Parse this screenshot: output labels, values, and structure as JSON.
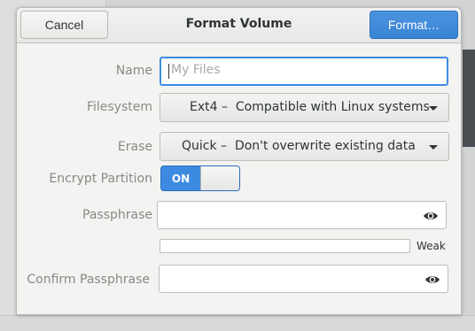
{
  "dialog": {
    "title": "Format Volume",
    "cancel_label": "Cancel",
    "format_label": "Format…"
  },
  "form": {
    "name": {
      "label": "Name",
      "value": "",
      "placeholder": "My Files"
    },
    "filesystem": {
      "label": "Filesystem",
      "selected": "Ext4 –  Compatible with Linux systems"
    },
    "erase": {
      "label": "Erase",
      "selected": "Quick –  Don't overwrite existing data"
    },
    "encrypt": {
      "label": "Encrypt Partition",
      "state": "ON"
    },
    "passphrase": {
      "label": "Passphrase",
      "value": "",
      "strength_label": "Weak",
      "strength_level": 0
    },
    "confirm": {
      "label": "Confirm Passphrase",
      "value": ""
    }
  },
  "icons": {
    "reveal": "eye-icon",
    "dropdown": "chevron-down-icon"
  },
  "colors": {
    "accent": "#3d8be1",
    "dialog_bg": "#f3f3f2",
    "label": "#888a85"
  }
}
